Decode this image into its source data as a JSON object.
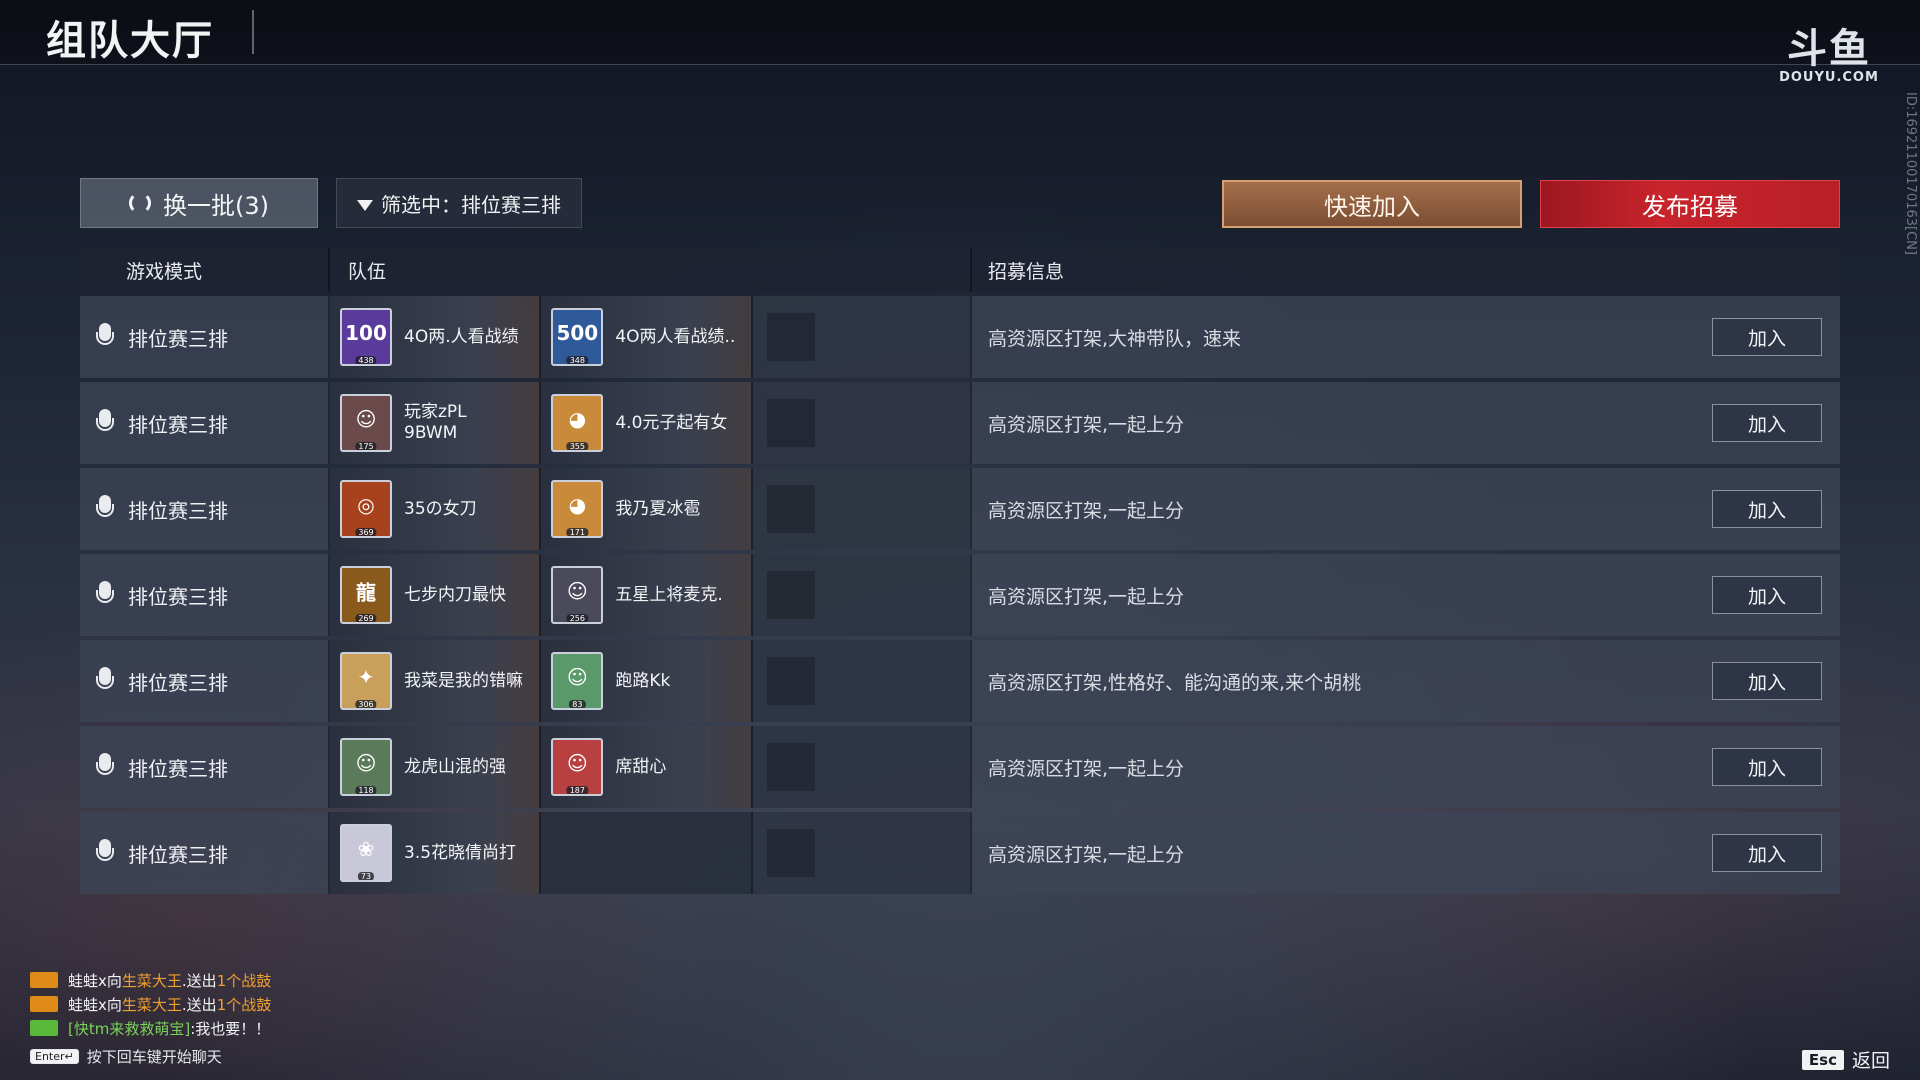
{
  "header": {
    "title": "组队大厅",
    "logo_mark": "斗鱼",
    "logo_text": "DOUYU.COM",
    "stream_id": "ID:16921100170163[CN]"
  },
  "controls": {
    "refresh_label": "换一批(3)",
    "filter_label": "筛选中：排位赛三排",
    "quick_join_label": "快速加入",
    "publish_label": "发布招募"
  },
  "table": {
    "headers": {
      "mode": "游戏模式",
      "team": "队伍",
      "info": "招募信息"
    },
    "join_label": "加入",
    "rows": [
      {
        "mode": "排位赛三排",
        "p1": {
          "name": "4O两.人看战绩",
          "level": "438",
          "face": "100",
          "color": "#5a3a9a"
        },
        "p2": {
          "name": "4O两人看战绩..",
          "level": "348",
          "face": "500",
          "color": "#2f5a9a"
        },
        "info": "高资源区打架,大神带队，速来"
      },
      {
        "mode": "排位赛三排",
        "p1": {
          "name": "玩家zPL 9BWM",
          "level": "175",
          "face": "☺",
          "color": "#6a4a4a"
        },
        "p2": {
          "name": "4.0元子起有女",
          "level": "355",
          "face": "◕",
          "color": "#c98a3a"
        },
        "info": "高资源区打架,一起上分"
      },
      {
        "mode": "排位赛三排",
        "p1": {
          "name": "35の女刀",
          "level": "369",
          "face": "◎",
          "color": "#a8421c"
        },
        "p2": {
          "name": "我乃夏冰雹",
          "level": "171",
          "face": "◕",
          "color": "#c98a3a"
        },
        "info": "高资源区打架,一起上分"
      },
      {
        "mode": "排位赛三排",
        "p1": {
          "name": "七步内刀最快",
          "level": "269",
          "face": "龍",
          "color": "#8a5a1c"
        },
        "p2": {
          "name": "五星上将麦克.",
          "level": "256",
          "face": "☺",
          "color": "#4a4a5a"
        },
        "info": "高资源区打架,一起上分"
      },
      {
        "mode": "排位赛三排",
        "p1": {
          "name": "我菜是我的错嘛",
          "level": "306",
          "face": "✦",
          "color": "#c9a05a"
        },
        "p2": {
          "name": "跑路Kk",
          "level": "83",
          "face": "☺",
          "color": "#5a9a6a"
        },
        "info": "高资源区打架,性格好、能沟通的来,来个胡桃"
      },
      {
        "mode": "排位赛三排",
        "p1": {
          "name": "龙虎山混的强",
          "level": "118",
          "face": "☺",
          "color": "#5a7a5a"
        },
        "p2": {
          "name": "席甜心",
          "level": "187",
          "face": "☺",
          "color": "#b84040"
        },
        "info": "高资源区打架,一起上分"
      },
      {
        "mode": "排位赛三排",
        "p1": {
          "name": "3.5花晓倩尚打",
          "level": "73",
          "face": "❀",
          "color": "#c8c8d8"
        },
        "p2": null,
        "info": "高资源区打架,一起上分"
      }
    ]
  },
  "chat": {
    "lines": [
      {
        "user": "蛙蛙x向",
        "target": "生菜大王",
        "mid": ".送出",
        "count": "1个",
        "item": "战鼓",
        "icon_color": "#e08a1a"
      },
      {
        "user": "蛙蛙x向",
        "target": "生菜大王",
        "mid": ".送出",
        "count": "1个",
        "item": "战鼓",
        "icon_color": "#e08a1a"
      }
    ],
    "message": {
      "user": "[快tm来救救萌宝]",
      "text": ":我也要！！",
      "icon_color": "#5ab83a"
    },
    "enter_key": "Enter↵",
    "hint": "按下回车键开始聊天"
  },
  "footer": {
    "esc_key": "Esc",
    "back_label": "返回"
  }
}
